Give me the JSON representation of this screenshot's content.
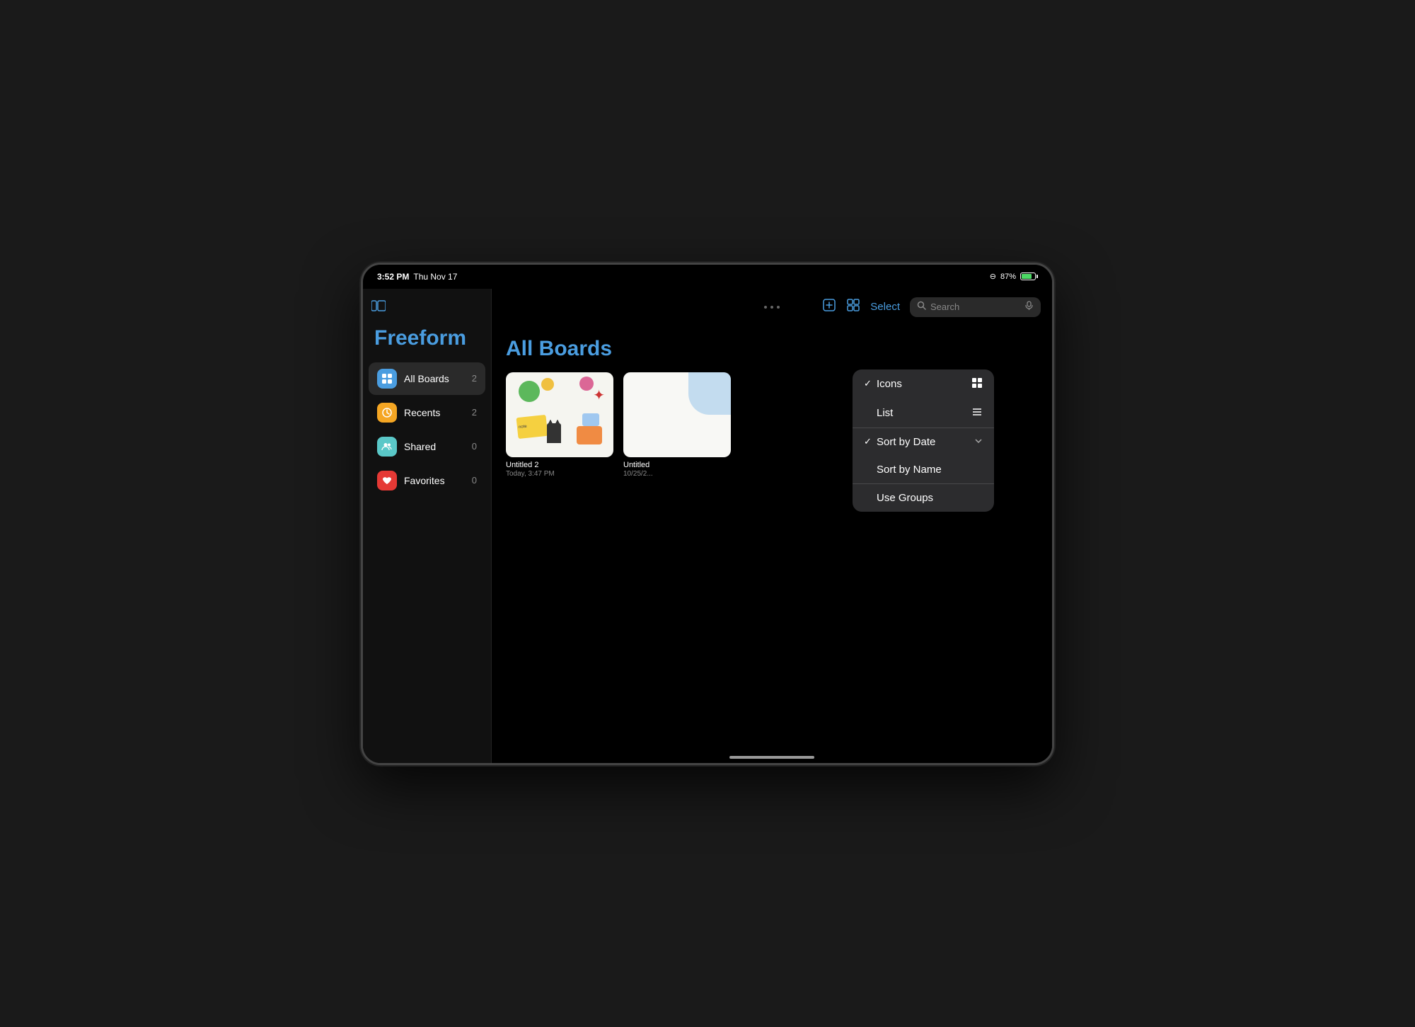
{
  "status_bar": {
    "time": "3:52 PM",
    "date": "Thu Nov 17",
    "battery_pct": "87%",
    "wifi": "wifi"
  },
  "sidebar": {
    "toggle_icon": "⊞",
    "app_title": "Freeform",
    "items": [
      {
        "id": "all-boards",
        "label": "All Boards",
        "count": "2",
        "icon": "🟦",
        "icon_type": "blue",
        "active": true
      },
      {
        "id": "recents",
        "label": "Recents",
        "count": "2",
        "icon": "🟠",
        "icon_type": "orange",
        "active": false
      },
      {
        "id": "shared",
        "label": "Shared",
        "count": "0",
        "icon": "👥",
        "icon_type": "teal",
        "active": false
      },
      {
        "id": "favorites",
        "label": "Favorites",
        "count": "0",
        "icon": "❤️",
        "icon_type": "red",
        "active": false
      }
    ]
  },
  "toolbar": {
    "dots": [
      "•",
      "•",
      "•"
    ],
    "new_board_label": "✏️",
    "grid_icon": "⊞",
    "select_label": "Select",
    "search_placeholder": "Search",
    "mic_icon": "🎙"
  },
  "main": {
    "page_title": "All Boards",
    "boards": [
      {
        "id": "board1",
        "title": "Untitled 2",
        "date": "Today, 3:47 PM",
        "type": "colorful"
      },
      {
        "id": "board2",
        "title": "Untitled",
        "date": "10/25/2...",
        "type": "plain"
      }
    ]
  },
  "dropdown": {
    "items": [
      {
        "id": "icons",
        "label": "Icons",
        "checked": true,
        "icon": "⊞",
        "has_chevron": false
      },
      {
        "id": "list",
        "label": "List",
        "checked": false,
        "icon": "≡",
        "has_chevron": false
      },
      {
        "id": "sort-by-date",
        "label": "Sort by Date",
        "checked": true,
        "icon": "",
        "has_chevron": true
      },
      {
        "id": "sort-by-name",
        "label": "Sort by Name",
        "checked": false,
        "icon": "",
        "has_chevron": false
      },
      {
        "id": "use-groups",
        "label": "Use Groups",
        "checked": false,
        "icon": "",
        "has_chevron": false
      }
    ]
  }
}
